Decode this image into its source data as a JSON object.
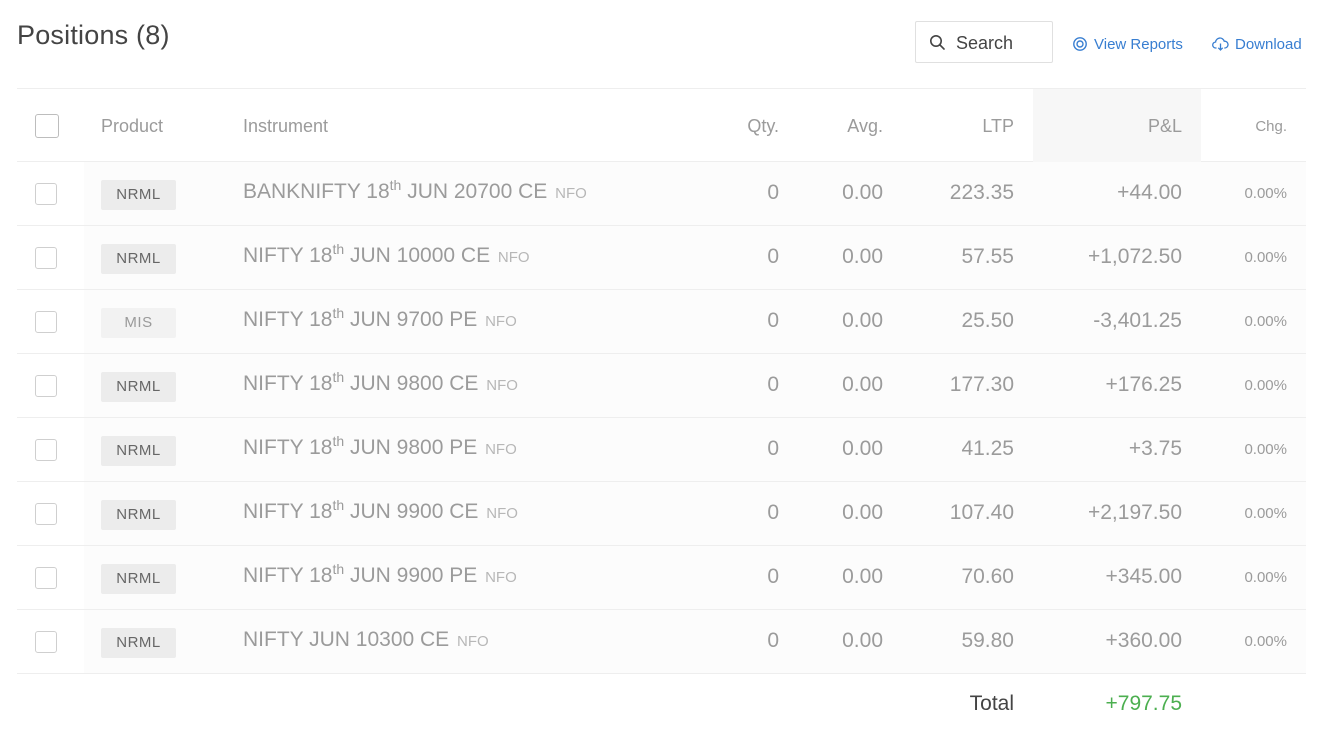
{
  "header": {
    "title": "Positions (8)",
    "search_placeholder": "Search",
    "view_reports_label": "View Reports",
    "download_label": "Download"
  },
  "table": {
    "columns": {
      "product": "Product",
      "instrument": "Instrument",
      "qty": "Qty.",
      "avg": "Avg.",
      "ltp": "LTP",
      "pnl": "P&L",
      "chg": "Chg."
    },
    "rows": [
      {
        "product": "NRML",
        "name_pre": "BANKNIFTY 18",
        "sup": "th",
        "name_post": " JUN 20700 CE",
        "exchange": "NFO",
        "qty": "0",
        "avg": "0.00",
        "ltp": "223.35",
        "pnl": "+44.00",
        "chg": "0.00%"
      },
      {
        "product": "NRML",
        "name_pre": "NIFTY 18",
        "sup": "th",
        "name_post": " JUN 10000 CE",
        "exchange": "NFO",
        "qty": "0",
        "avg": "0.00",
        "ltp": "57.55",
        "pnl": "+1,072.50",
        "chg": "0.00%"
      },
      {
        "product": "MIS",
        "name_pre": "NIFTY 18",
        "sup": "th",
        "name_post": " JUN 9700 PE",
        "exchange": "NFO",
        "qty": "0",
        "avg": "0.00",
        "ltp": "25.50",
        "pnl": "-3,401.25",
        "chg": "0.00%"
      },
      {
        "product": "NRML",
        "name_pre": "NIFTY 18",
        "sup": "th",
        "name_post": " JUN 9800 CE",
        "exchange": "NFO",
        "qty": "0",
        "avg": "0.00",
        "ltp": "177.30",
        "pnl": "+176.25",
        "chg": "0.00%"
      },
      {
        "product": "NRML",
        "name_pre": "NIFTY 18",
        "sup": "th",
        "name_post": " JUN 9800 PE",
        "exchange": "NFO",
        "qty": "0",
        "avg": "0.00",
        "ltp": "41.25",
        "pnl": "+3.75",
        "chg": "0.00%"
      },
      {
        "product": "NRML",
        "name_pre": "NIFTY 18",
        "sup": "th",
        "name_post": " JUN 9900 CE",
        "exchange": "NFO",
        "qty": "0",
        "avg": "0.00",
        "ltp": "107.40",
        "pnl": "+2,197.50",
        "chg": "0.00%"
      },
      {
        "product": "NRML",
        "name_pre": "NIFTY 18",
        "sup": "th",
        "name_post": " JUN 9900 PE",
        "exchange": "NFO",
        "qty": "0",
        "avg": "0.00",
        "ltp": "70.60",
        "pnl": "+345.00",
        "chg": "0.00%"
      },
      {
        "product": "NRML",
        "name_pre": "NIFTY JUN 10300 CE",
        "sup": "",
        "name_post": "",
        "exchange": "NFO",
        "qty": "0",
        "avg": "0.00",
        "ltp": "59.80",
        "pnl": "+360.00",
        "chg": "0.00%"
      }
    ],
    "total_label": "Total",
    "total_value": "+797.75"
  },
  "colors": {
    "link": "#387ed1",
    "profit": "#4caf50",
    "muted_text": "#9b9b9b"
  },
  "icons": {
    "search": "search-icon",
    "view_reports": "reports-icon",
    "download": "cloud-download-icon"
  }
}
